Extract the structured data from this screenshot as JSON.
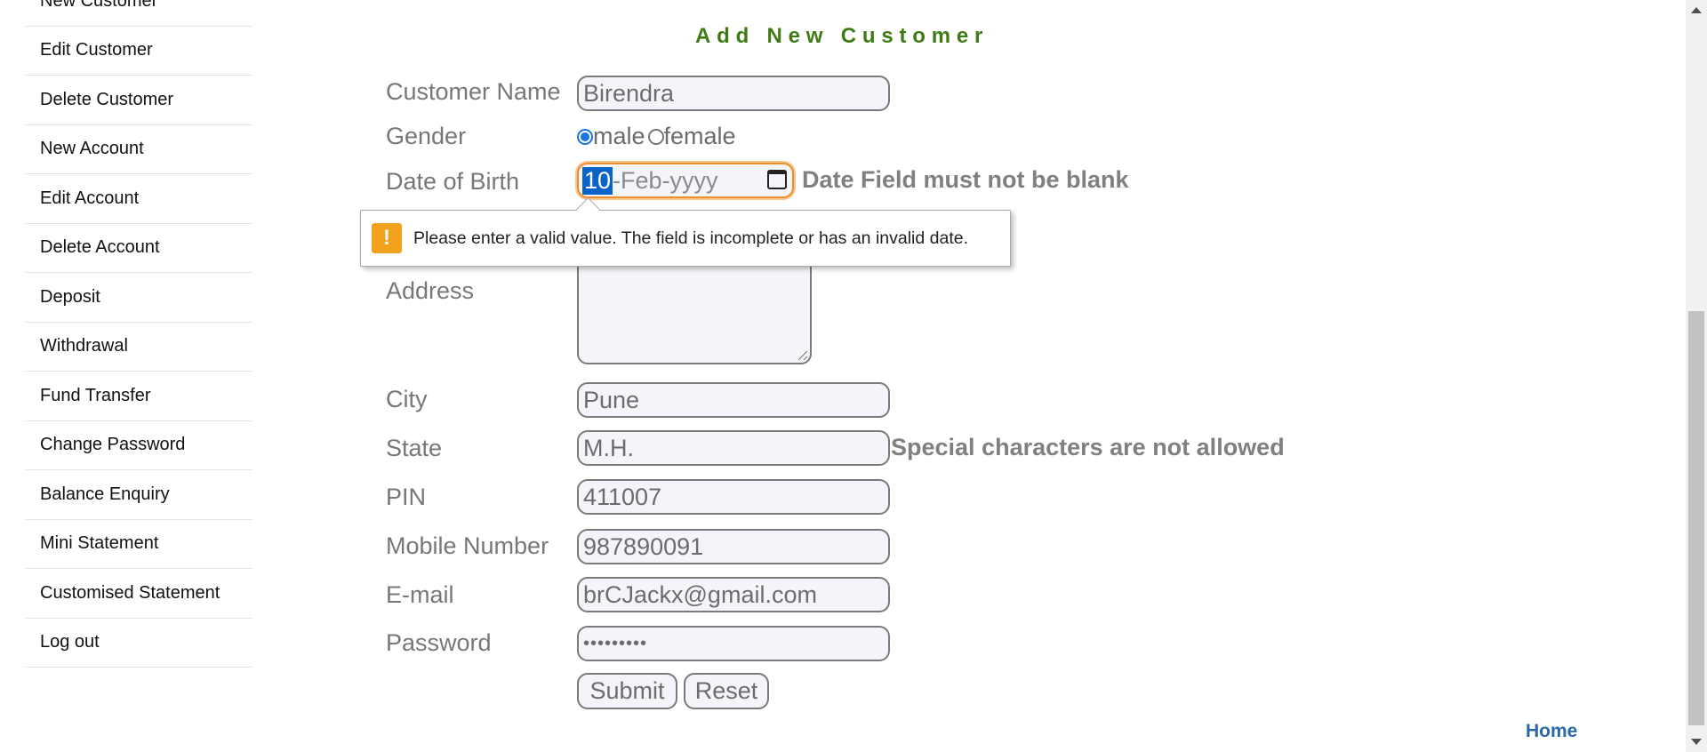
{
  "sidebar": {
    "items": [
      {
        "label": "New Customer"
      },
      {
        "label": "Edit Customer"
      },
      {
        "label": "Delete Customer"
      },
      {
        "label": "New Account"
      },
      {
        "label": "Edit Account"
      },
      {
        "label": "Delete Account"
      },
      {
        "label": "Deposit"
      },
      {
        "label": "Withdrawal"
      },
      {
        "label": "Fund Transfer"
      },
      {
        "label": "Change Password"
      },
      {
        "label": "Balance Enquiry"
      },
      {
        "label": "Mini Statement"
      },
      {
        "label": "Customised Statement"
      },
      {
        "label": "Log out"
      }
    ]
  },
  "form": {
    "heading": "Add New Customer",
    "labels": {
      "customer_name": "Customer Name",
      "gender": "Gender",
      "dob": "Date of Birth",
      "address": "Address",
      "city": "City",
      "state": "State",
      "pin": "PIN",
      "mobile": "Mobile Number",
      "email": "E-mail",
      "password": "Password"
    },
    "values": {
      "customer_name": "Birendra",
      "dob_day": "10",
      "dob_rest": "-Feb-yyyy",
      "city": "Pune",
      "state": "M.H.",
      "pin": "411007",
      "mobile": "987890091",
      "email": "brCJackx@gmail.com",
      "password": "•••••••••"
    },
    "gender_options": {
      "male": "male",
      "female": "female",
      "selected": "male"
    },
    "errors": {
      "dob": "Date Field must not be blank",
      "state": "Special characters are not allowed"
    },
    "tooltip": "Please enter a valid value. The field is incomplete or has an invalid date.",
    "buttons": {
      "submit": "Submit",
      "reset": "Reset"
    }
  },
  "footer": {
    "home_link": "Home"
  },
  "icons": {
    "calendar": "calendar-icon",
    "warning": "warning-icon"
  },
  "colors": {
    "heading": "#3f7b14",
    "link": "#2a69a8",
    "focus": "#ef8d2a",
    "warning": "#f2a11c",
    "radio_selected": "#1a73e8"
  }
}
